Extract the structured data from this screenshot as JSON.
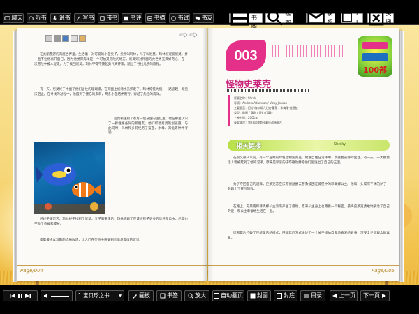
{
  "toolbar": {
    "items": [
      {
        "label": "聊天",
        "icon": "chat-icon"
      },
      {
        "label": "听书",
        "icon": "headphones-icon"
      },
      {
        "label": "说书",
        "icon": "microphone-icon"
      },
      {
        "label": "写书",
        "icon": "pen-icon"
      },
      {
        "label": "带书",
        "icon": "book-carry-icon"
      },
      {
        "label": "书评",
        "icon": "review-icon"
      },
      {
        "label": "书摘",
        "icon": "excerpt-icon"
      },
      {
        "label": "书试",
        "icon": "test-icon"
      },
      {
        "label": "书友",
        "icon": "friends-icon"
      }
    ],
    "right": {
      "bookshelf": "藏书阁",
      "search": "搜索",
      "contact": "联系",
      "ratio": "1 : 1",
      "close": "关闭"
    }
  },
  "left_page": {
    "paragraphs": [
      "在关丽鳌游的海底世界里，生活着一对可爱的小鱼父子，父亲叫玛林，儿子叫尼莫。玛林很宠爱尼莫，并一直不让他离开自己，因为他觉得海洋是一个可怕又危险的地方。尼莫则对外面的大世界充满好奇心，在一次冒险中被人捉走。为了找回尼莫，玛林不得不鼓起勇气离开家，踏上了寻找儿子的旅程。",
      "有一天，尼莫终于冲出了他们居住的珊瑚礁，在海面上被潜水员抓走了。玛林惊慌失措，一路追赶，却无法阻止。在寻找的过程中，他遇到了健忘的多莉，两条小鱼结伴而行，穿越了危险的海洋。",
      "尼莫被送到了悉尼一位牙医的鱼缸里，他在那里认识了一群性格各异的新朋友，他们帮助尼莫策划逃跑。与此同时，玛林和多莉经历了鲨鱼、水母、海龟等种种考验。",
      "经过千辛万苦，玛林终于找到了尼莫，父子俩重逢后，玛林明白了应该给孩子更多的信任和自由，尼莫也学会了勇敢和成长。",
      "电影最终以温馨的结局收场，让人们在笑声中感受到亲情与友情的可贵。"
    ],
    "page_number": "Page/004"
  },
  "right_page": {
    "badge": "003",
    "title": "怪物史莱克",
    "info_lines": [
      "原版名称：Shrek",
      "导演：Andrew Adamson / Vicky Jenson",
      "主要配音：迈克·梅尔斯 / 艾迪·墨菲 / 卡梅隆·迪亚兹",
      "类型：动画 / 喜剧 / 奇幻 / 冒险",
      "上映时间：2001年",
      "获奖情况：第74届奥斯卡最佳动画长片"
    ],
    "related_label": "相关链接",
    "related_tag": "Shreky",
    "paragraphs": [
      "在很久很久以前，有一个丑陋的绿色怪物史莱克，他独自住在沼泽中，享受着安静的生活。有一天，一大群童话人物被赶到了他的沼泽，原来是邪恶的法夸德勋爵把他们驱逐出了自己的王国。",
      "为了夺回自己的沼泽，史莱克答应法夸德勋爵去营救被困在城堡中的菲奥娜公主。他和一头喋喋不休的驴子一起踏上了冒险旅程。",
      "在路上，史莱克和菲奥娜公主渐渐产生了感情，原来公主身上也藏着一个秘密。最终史莱克勇敢地表达了自己的爱，和公主幸福地生活在一起。",
      "这部影片打破了传统童话的模式，用幽默的方式讲述了一个关于接纳自我与真爱的故事，深受全世界观众的喜爱。"
    ],
    "page_number": "Page/005",
    "logo_text": "100部"
  },
  "bottombar": {
    "chapter": "1.宝贝珍之书",
    "buttons": [
      {
        "label": "画板",
        "icon": "pencil-icon"
      },
      {
        "label": "书签",
        "icon": "bookmark-icon"
      },
      {
        "label": "放大",
        "icon": "zoom-in-icon"
      },
      {
        "label": "自动翻页",
        "icon": "auto-page-icon"
      },
      {
        "label": "封面",
        "icon": "cover-icon"
      },
      {
        "label": "封底",
        "icon": "back-cover-icon"
      },
      {
        "label": "目录",
        "icon": "contents-icon"
      },
      {
        "label": "上一页",
        "icon": "prev-icon"
      },
      {
        "label": "下一页",
        "icon": "next-icon"
      }
    ]
  }
}
